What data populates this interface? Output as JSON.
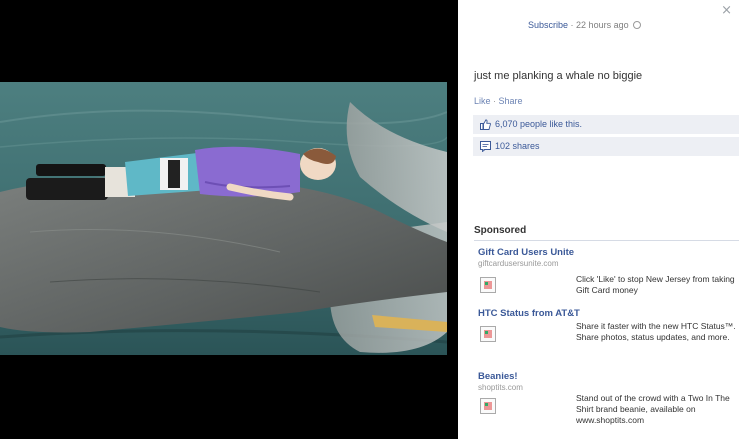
{
  "post": {
    "subscribe": "Subscribe",
    "time_ago": "22 hours ago",
    "caption": "just me planking a whale no biggie",
    "like": "Like",
    "share": "Share",
    "likes": "6,070 people like this.",
    "shares": "102 shares",
    "close_glyph": "×"
  },
  "sponsored_label": "Sponsored",
  "ads": [
    {
      "title": "Gift Card Users Unite",
      "domain": "giftcardusersunite.com",
      "body": "Click 'Like' to stop New Jersey from taking Gift Card money"
    },
    {
      "title": "HTC Status from AT&T",
      "domain": "",
      "body": "Share it faster with the new HTC Status™. Share photos, status updates, and more."
    },
    {
      "title": "Beanies!",
      "domain": "shoptits.com",
      "body": "Stand out of the crowd with a Two In The Shirt brand beanie, available on www.shoptits.com"
    }
  ],
  "colors": {
    "link": "#3b5998",
    "ufi_bg": "#edeff4",
    "water": "#3f6f71",
    "whale": "#6b6e6c"
  },
  "icons": {
    "close": "close-icon",
    "globe": "globe-icon",
    "like": "thumbs-up-icon",
    "share": "share-icon",
    "ad_image": "broken-image-icon"
  }
}
